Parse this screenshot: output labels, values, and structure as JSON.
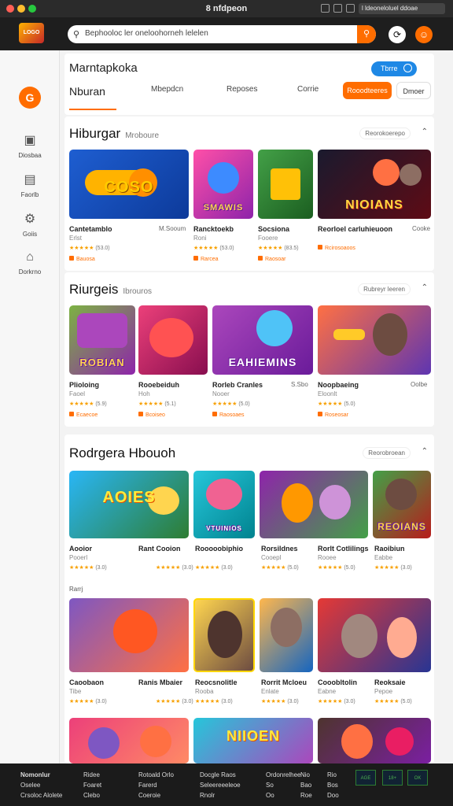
{
  "browser": {
    "title": "8 nfdpeon",
    "url": "l ldeoneloluel ddoae"
  },
  "header": {
    "logo_text": "LOGO",
    "search_placeholder": "Bephooloc ler oneloohorneh lelelen"
  },
  "sidebar": {
    "user_initial": "G",
    "items": [
      {
        "label": "Diosbaa",
        "icon": "window-icon"
      },
      {
        "label": "Faorlb",
        "icon": "document-icon"
      },
      {
        "label": "Goiis",
        "icon": "gear-icon"
      },
      {
        "label": "Dorkrno",
        "icon": "house-icon"
      }
    ]
  },
  "topbar": {
    "title": "Marntapkoka",
    "button": "Tbrre",
    "tabs": [
      "Nburan",
      "Mbepdcn",
      "Reposes",
      "Corrie"
    ],
    "pill_primary": "Rooodteeres",
    "pill_secondary": "Dmoer"
  },
  "sections": [
    {
      "title": "Hiburgar",
      "subtitle": "Mroboure",
      "link": "Reorokoerepo",
      "games": [
        {
          "name": "Cantetamblo",
          "meta": "Erlst",
          "provider": "M.Sooum",
          "rating": "★★★★★",
          "reviews": "(53.0)",
          "tag": "Bauosa",
          "art": "COSO"
        },
        {
          "name": "Rancktoekb",
          "meta": "Roni",
          "provider": "",
          "rating": "★★★★★",
          "reviews": "(53.0)",
          "tag": "Rarcea",
          "art": "SMAWIS"
        },
        {
          "name": "Socsiona",
          "meta": "Fooere",
          "provider": "",
          "rating": "★★★★★",
          "reviews": "(83.5)",
          "tag": "Raosoar",
          "art": ""
        },
        {
          "name": "Reorloel carluhieuoon",
          "meta": "",
          "provider": "Cooke",
          "rating": "",
          "reviews": "",
          "tag": "Rcirosoaoos",
          "art": "NIOIANS"
        }
      ]
    },
    {
      "title": "Riurgeis",
      "subtitle": "Ibrouros",
      "link": "Rubreyr leeren",
      "games": [
        {
          "name": "Plioloing",
          "meta": "Faoel",
          "provider": "",
          "rating": "★★★★★",
          "reviews": "(5.9)",
          "tag": "Ecaecoe",
          "art": "ROBIAN"
        },
        {
          "name": "Rooebeiduh",
          "meta": "Hoh",
          "provider": "",
          "rating": "★★★★★",
          "reviews": "(5.1)",
          "tag": "Bcoiseo",
          "art": ""
        },
        {
          "name": "Rorleb Cranles",
          "meta": "Nooer",
          "provider": "S.Sbo",
          "rating": "★★★★★",
          "reviews": "(5.0)",
          "tag": "Raosoaes",
          "art": "EAHIEMINS"
        },
        {
          "name": "Noopbaeing",
          "meta": "Eloonlt",
          "provider": "Oolbe",
          "rating": "★★★★★",
          "reviews": "(5.0)",
          "tag": "Roseosar",
          "art": ""
        }
      ]
    },
    {
      "title": "Rodrgera Hbouoh",
      "subtitle": "",
      "link": "Reorobroean",
      "games": [
        {
          "name": "Aooior",
          "meta": "Pooerl",
          "provider": "",
          "rating": "★★★★★",
          "reviews": "(3.0)",
          "tag": "",
          "art": "AOIES"
        },
        {
          "name": "Rant Cooion",
          "meta": "",
          "provider": "",
          "rating": "★★★★★",
          "reviews": "(3.0)",
          "tag": "",
          "art": "VTUINIOS"
        },
        {
          "name": "Rooooobiphio",
          "meta": "",
          "provider": "",
          "rating": "★★★★★",
          "reviews": "(3.0)",
          "tag": "",
          "art": ""
        },
        {
          "name": "Rorsildnes",
          "meta": "Cooepl",
          "provider": "",
          "rating": "★★★★★",
          "reviews": "(5.0)",
          "tag": "",
          "art": ""
        },
        {
          "name": "Rorlt Cotlilings",
          "meta": "Rooee",
          "provider": "",
          "rating": "★★★★★",
          "reviews": "(5.0)",
          "tag": "",
          "art": ""
        },
        {
          "name": "Raoibiun",
          "meta": "Eabbe",
          "provider": "",
          "rating": "★★★★★",
          "reviews": "(3.0)",
          "tag": "",
          "art": "REOIANS"
        }
      ]
    },
    {
      "title": "Rarrj",
      "subtitle": "",
      "link": "",
      "games": [
        {
          "name": "Caoobaon",
          "meta": "Tibe",
          "provider": "",
          "rating": "★★★★★",
          "reviews": "(3.0)",
          "tag": "",
          "art": ""
        },
        {
          "name": "Ranis Mbaier",
          "meta": "",
          "provider": "",
          "rating": "★★★★★",
          "reviews": "(3.0)",
          "tag": "",
          "art": ""
        },
        {
          "name": "Reocsnolitle",
          "meta": "Rooba",
          "provider": "",
          "rating": "★★★★★",
          "reviews": "(3.0)",
          "tag": "",
          "art": ""
        },
        {
          "name": "Rorrit Mcloeu",
          "meta": "Enlate",
          "provider": "",
          "rating": "★★★★★",
          "reviews": "(3.0)",
          "tag": "",
          "art": ""
        },
        {
          "name": "Cooobltolin",
          "meta": "Eabne",
          "provider": "",
          "rating": "★★★★★",
          "reviews": "(3.0)",
          "tag": "",
          "art": ""
        },
        {
          "name": "Reoksaie",
          "meta": "Pepoe",
          "provider": "",
          "rating": "★★★★★",
          "reviews": "(5.0)",
          "tag": "",
          "art": ""
        }
      ]
    },
    {
      "title": "",
      "subtitle": "",
      "link": "",
      "games": [
        {
          "name": "",
          "meta": "",
          "provider": "",
          "rating": "",
          "reviews": "",
          "tag": "",
          "art": ""
        },
        {
          "name": "",
          "meta": "",
          "provider": "",
          "rating": "",
          "reviews": "",
          "tag": "",
          "art": "NIIOEN"
        },
        {
          "name": "",
          "meta": "",
          "provider": "",
          "rating": "",
          "reviews": "",
          "tag": "",
          "art": ""
        }
      ]
    }
  ],
  "footer": {
    "col1": [
      "Nomonlur",
      "Oselee",
      "Crsoloc Alolete"
    ],
    "col2": [
      "Ridee",
      "Foaret",
      "Clebo"
    ],
    "col3": [
      "Rotoald Orlo",
      "Farerd",
      "Coeroie"
    ],
    "col4": [
      "Docgle Raos",
      "Seleereeeleoe",
      "Rnolr"
    ],
    "col5": [
      "Ordonrelhee",
      "So",
      "Oo"
    ],
    "col6": [
      "Nio",
      "Bao",
      "Roe"
    ],
    "col7": [
      "Rio",
      "Bos",
      "Doo"
    ],
    "badges": [
      "AGE",
      "18+",
      "OK"
    ]
  }
}
